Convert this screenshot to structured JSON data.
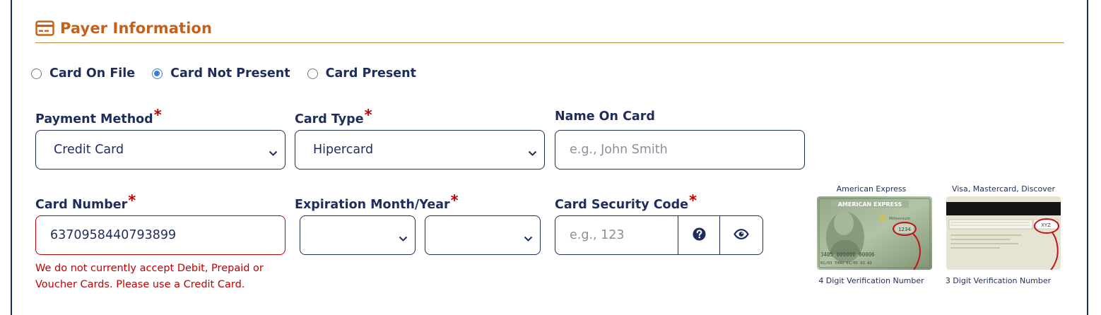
{
  "section": {
    "title": "Payer Information",
    "icon": "credit-card-icon",
    "title_color": "#c5601a"
  },
  "payment_options": [
    {
      "label": "Card On File",
      "selected": false
    },
    {
      "label": "Card Not Present",
      "selected": true
    },
    {
      "label": "Card Present",
      "selected": false
    }
  ],
  "fields": {
    "payment_method": {
      "label": "Payment Method",
      "required": "*",
      "value": "Credit Card"
    },
    "card_type": {
      "label": "Card Type",
      "required": "*",
      "value": "Hipercard"
    },
    "name_on_card": {
      "label": "Name On Card",
      "placeholder": "e.g., John Smith",
      "value": ""
    },
    "card_number": {
      "label": "Card Number",
      "required": "*",
      "value": "6370958440793899",
      "error": "We do not currently accept Debit, Prepaid or Voucher Cards. Please use a Credit Card."
    },
    "expiration": {
      "label": "Expiration Month/Year",
      "required": "*",
      "month": "",
      "year": ""
    },
    "security_code": {
      "label": "Card Security Code",
      "required": "*",
      "placeholder": "e.g., 123",
      "help_icon": "question-circle-icon",
      "toggle_icon": "eye-icon"
    }
  },
  "card_examples": [
    {
      "title": "American Express",
      "caption": "4 Digit Verification Number",
      "sample_code": "1234",
      "image_text": "AMERICAN EXPRESS",
      "image_subtext": "Millennium",
      "image_number": "3405 000000 00006",
      "image_dates": "01/03 THRU 01/05  03  A3"
    },
    {
      "title": "Visa, Mastercard, Discover",
      "caption": "3 Digit Verification Number",
      "sample_code": "XYZ"
    }
  ],
  "colors": {
    "navy": "#1f2d5c",
    "accent_orange": "#c5601a",
    "error_red": "#c00000",
    "radio_blue": "#3b7ddd"
  }
}
